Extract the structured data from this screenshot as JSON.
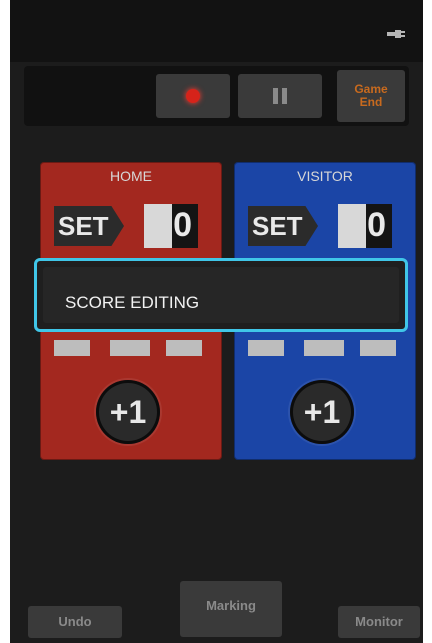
{
  "header": {
    "status_icon": "plug-icon",
    "record_icon": "record-icon",
    "pause_icon": "pause-icon",
    "game_end_label": "Game\nEnd"
  },
  "panels": {
    "home": {
      "title": "HOME",
      "set_label": "SET",
      "set_value": "0",
      "plus_label": "+1",
      "color": "#a3281f"
    },
    "visitor": {
      "title": "VISITOR",
      "set_label": "SET",
      "set_value": "0",
      "plus_label": "+1",
      "color": "#1b45a6"
    }
  },
  "popup": {
    "label": "SCORE EDITING",
    "border_color": "#40c6e8"
  },
  "footer": {
    "undo_label": "Undo",
    "marking_label": "Marking",
    "monitor_label": "Monitor"
  }
}
